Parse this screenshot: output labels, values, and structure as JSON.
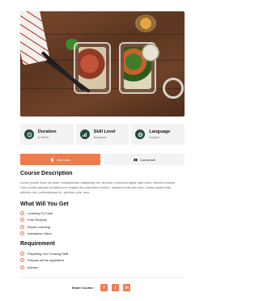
{
  "info_cards": [
    {
      "title": "Duration",
      "sub": "6 Week",
      "icon": "clock-icon"
    },
    {
      "title": "Skill Level",
      "sub": "Beginner",
      "icon": "bar-chart-icon"
    },
    {
      "title": "Language",
      "sub": "English",
      "icon": "globe-icon"
    }
  ],
  "tabs": [
    {
      "label": "Overview",
      "active": true,
      "icon": "file-icon"
    },
    {
      "label": "Curriculum",
      "active": false,
      "icon": "book-icon"
    }
  ],
  "course_description": {
    "heading": "Course Description",
    "text": "Lorem ipsum dolor sit amet, consectetuer adipiscing elit. Aenean commodo ligula eget dolor. Aenean massa. Cum sociis natoque penatibus et magnis dis parturient montes, nascetur ridiculus mus. Donec quam felis, ultricies nec, pellentesque eu, pretium quis, sem."
  },
  "what_you_get": {
    "heading": "What Will You Get",
    "items": [
      "Learning To Cook",
      "Free Recipes",
      "Ebook Learning",
      "Interactive Video"
    ]
  },
  "requirement": {
    "heading": "Requirement",
    "items": [
      "Preparing You Cooking Stuff",
      "Prepare all the ingredient",
      "Kitchen"
    ]
  },
  "share": {
    "label": "Share Course :",
    "buttons": [
      {
        "icon": "facebook-icon",
        "glyph": "f"
      },
      {
        "icon": "twitter-icon",
        "glyph": "t"
      },
      {
        "icon": "linkedin-icon",
        "glyph": "in"
      }
    ]
  },
  "colors": {
    "accent": "#ed7d4f",
    "icon_bg": "#1f4b43",
    "card_bg": "#f3f3f3"
  }
}
